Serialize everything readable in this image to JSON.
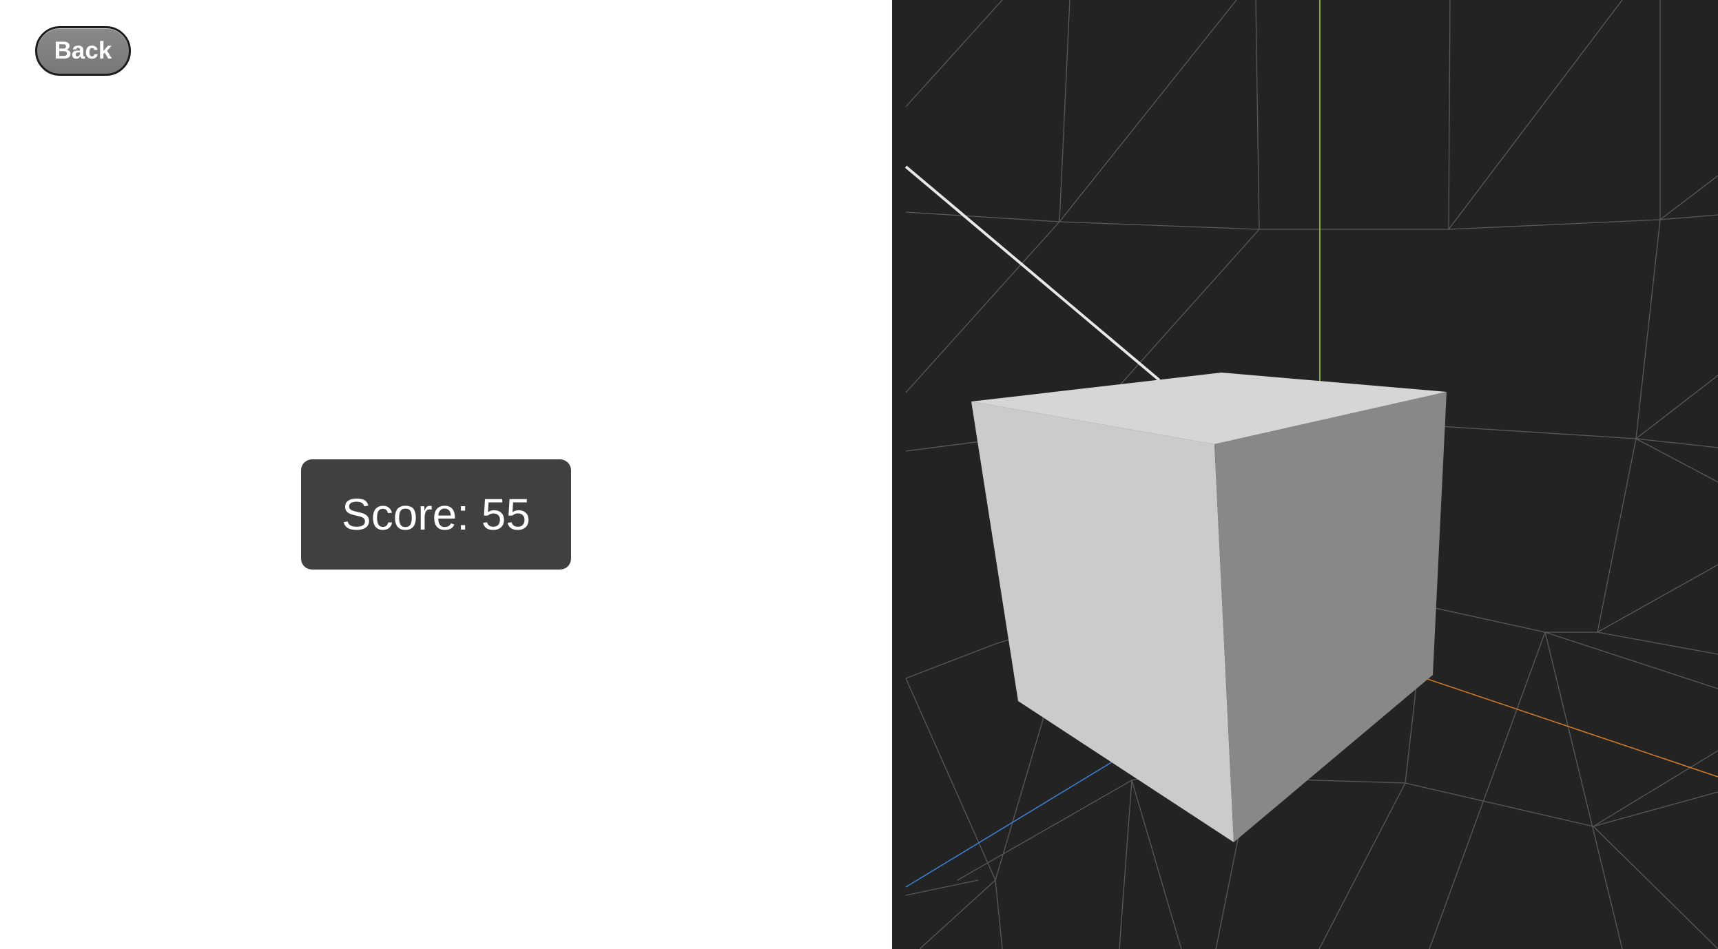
{
  "back_button": {
    "label": "Back"
  },
  "score": {
    "text": "Score: 55",
    "value": 55
  },
  "viewport": {
    "background": "#232323",
    "grid_color": "#5a5a5a",
    "axis_colors": {
      "x": "#d07a2a",
      "y": "#9ccc3a",
      "z": "#3a7fd0"
    },
    "cube_colors": {
      "top": "#d6d6d6",
      "front": "#cbcbcb",
      "side": "#888888"
    }
  }
}
